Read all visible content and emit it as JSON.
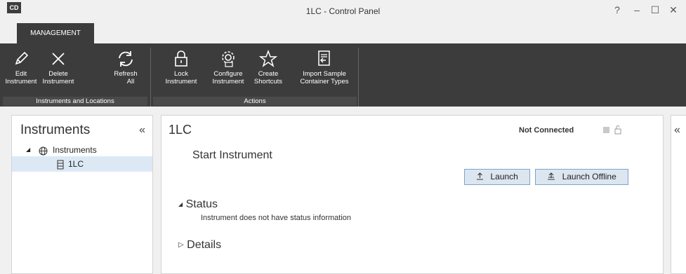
{
  "window": {
    "title": "1LC - Control Panel",
    "logo": "CD",
    "help": "?",
    "minimize": "–",
    "maximize": "☐",
    "close": "✕"
  },
  "ribbon": {
    "tab_label": "MANAGEMENT",
    "buttons": {
      "edit_line1": "Edit",
      "edit_line2": "Instrument",
      "delete_line1": "Delete",
      "delete_line2": "Instrument",
      "refresh_line1": "Refresh",
      "refresh_line2": "All",
      "lock_line1": "Lock",
      "lock_line2": "Instrument",
      "configure_line1": "Configure",
      "configure_line2": "Instrument",
      "shortcuts_line1": "Create",
      "shortcuts_line2": "Shortcuts",
      "import_line1": "Import Sample",
      "import_line2": "Container Types"
    },
    "groups": {
      "instruments": "Instruments and Locations",
      "actions": "Actions"
    }
  },
  "left_panel": {
    "title": "Instruments",
    "collapse": "«",
    "tree": {
      "root_expander": "◢",
      "root_label": "Instruments",
      "child_label": "1LC"
    }
  },
  "main_panel": {
    "title": "1LC",
    "connection_status": "Not Connected",
    "subtitle": "Start Instrument",
    "launch_label": "Launch",
    "launch_offline_label": "Launch Offline",
    "status_expander": "◢",
    "status_heading": "Status",
    "status_text": "Instrument does not have status information",
    "details_expander": "▷",
    "details_heading": "Details"
  },
  "right_panel": {
    "collapse": "«"
  },
  "colors": {
    "ribbon_bg": "#3c3c3c",
    "selected_row": "#dce9f5",
    "button_bg": "#dce6f0",
    "button_border": "#7ea4c8"
  }
}
